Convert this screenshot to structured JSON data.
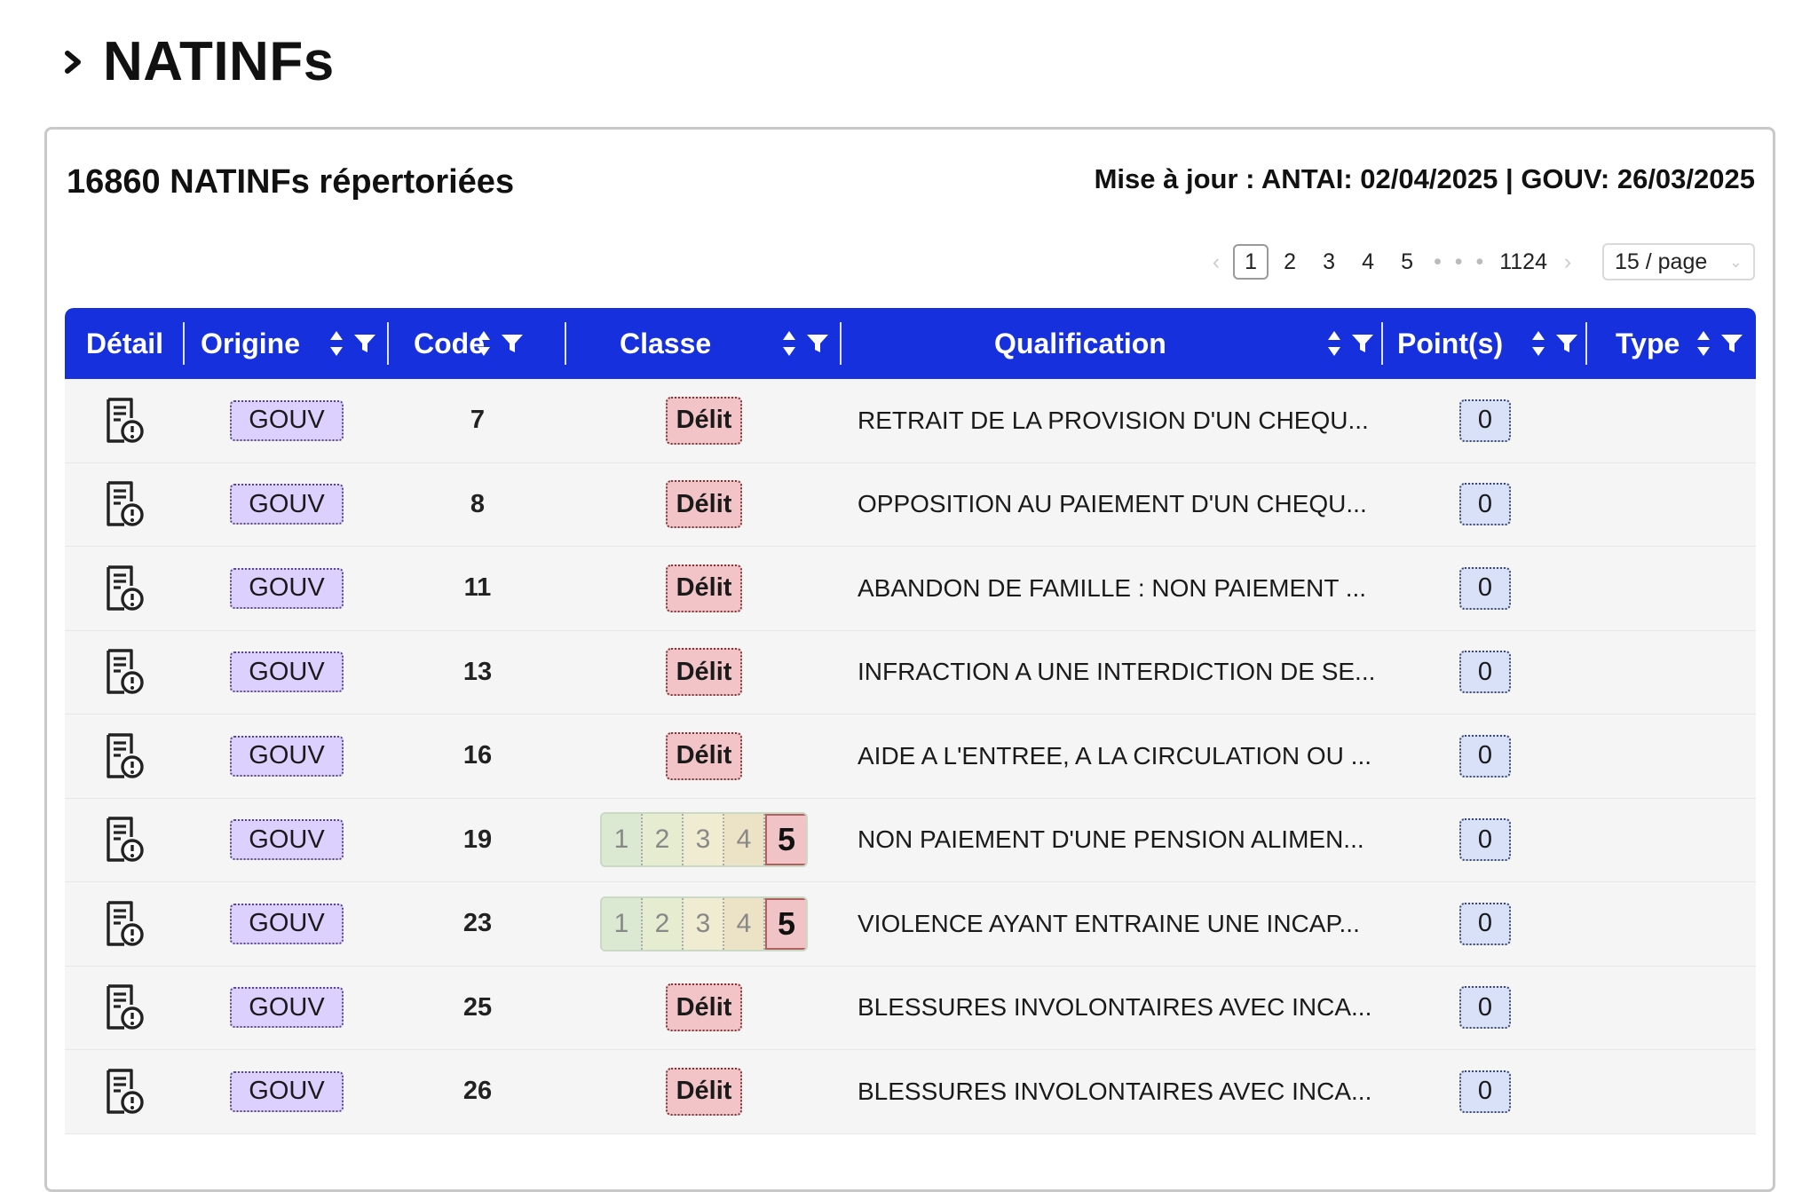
{
  "heading": {
    "title": "NATINFs"
  },
  "panel": {
    "count_title": "16860 NATINFs répertoriées",
    "update_info": "Mise à jour : ANTAI: 02/04/2025 | GOUV: 26/03/2025"
  },
  "pagination": {
    "pages": [
      "1",
      "2",
      "3",
      "4",
      "5"
    ],
    "active_page": "1",
    "ellipsis": "• • •",
    "last_page": "1124",
    "page_size": "15 / page"
  },
  "table": {
    "columns": [
      "Détail",
      "Origine",
      "Code",
      "Classe",
      "Qualification",
      "Point(s)",
      "Type"
    ],
    "rows": [
      {
        "origine": "GOUV",
        "code": "7",
        "classe": "Délit",
        "qualification": "RETRAIT DE LA PROVISION D'UN CHEQU...",
        "points": "0"
      },
      {
        "origine": "GOUV",
        "code": "8",
        "classe": "Délit",
        "qualification": "OPPOSITION AU PAIEMENT D'UN CHEQU...",
        "points": "0"
      },
      {
        "origine": "GOUV",
        "code": "11",
        "classe": "Délit",
        "qualification": "ABANDON DE FAMILLE : NON PAIEMENT ...",
        "points": "0"
      },
      {
        "origine": "GOUV",
        "code": "13",
        "classe": "Délit",
        "qualification": "INFRACTION A UNE INTERDICTION DE SE...",
        "points": "0"
      },
      {
        "origine": "GOUV",
        "code": "16",
        "classe": "Délit",
        "qualification": "AIDE A L'ENTREE, A LA CIRCULATION OU ...",
        "points": "0"
      },
      {
        "origine": "GOUV",
        "code": "19",
        "classe_scale": [
          "1",
          "2",
          "3",
          "4",
          "5"
        ],
        "qualification": "NON PAIEMENT D'UNE PENSION ALIMEN...",
        "points": "0"
      },
      {
        "origine": "GOUV",
        "code": "23",
        "classe_scale": [
          "1",
          "2",
          "3",
          "4",
          "5"
        ],
        "qualification": "VIOLENCE AYANT ENTRAINE UNE INCAP...",
        "points": "0"
      },
      {
        "origine": "GOUV",
        "code": "25",
        "classe": "Délit",
        "qualification": "BLESSURES INVOLONTAIRES AVEC INCA...",
        "points": "0"
      },
      {
        "origine": "GOUV",
        "code": "26",
        "classe": "Délit",
        "qualification": "BLESSURES INVOLONTAIRES AVEC INCA...",
        "points": "0"
      }
    ]
  },
  "colors": {
    "header_bg": "#1530dc",
    "origin_tag_bg": "#dcd0ff",
    "classe_tag_bg": "#f2c4c8",
    "points_tag_bg": "#d8e1f7"
  },
  "icons": {
    "heading": "chevron-right-icon",
    "detail": "document-info-icon",
    "sort": "sort-icon",
    "filter": "filter-icon"
  }
}
